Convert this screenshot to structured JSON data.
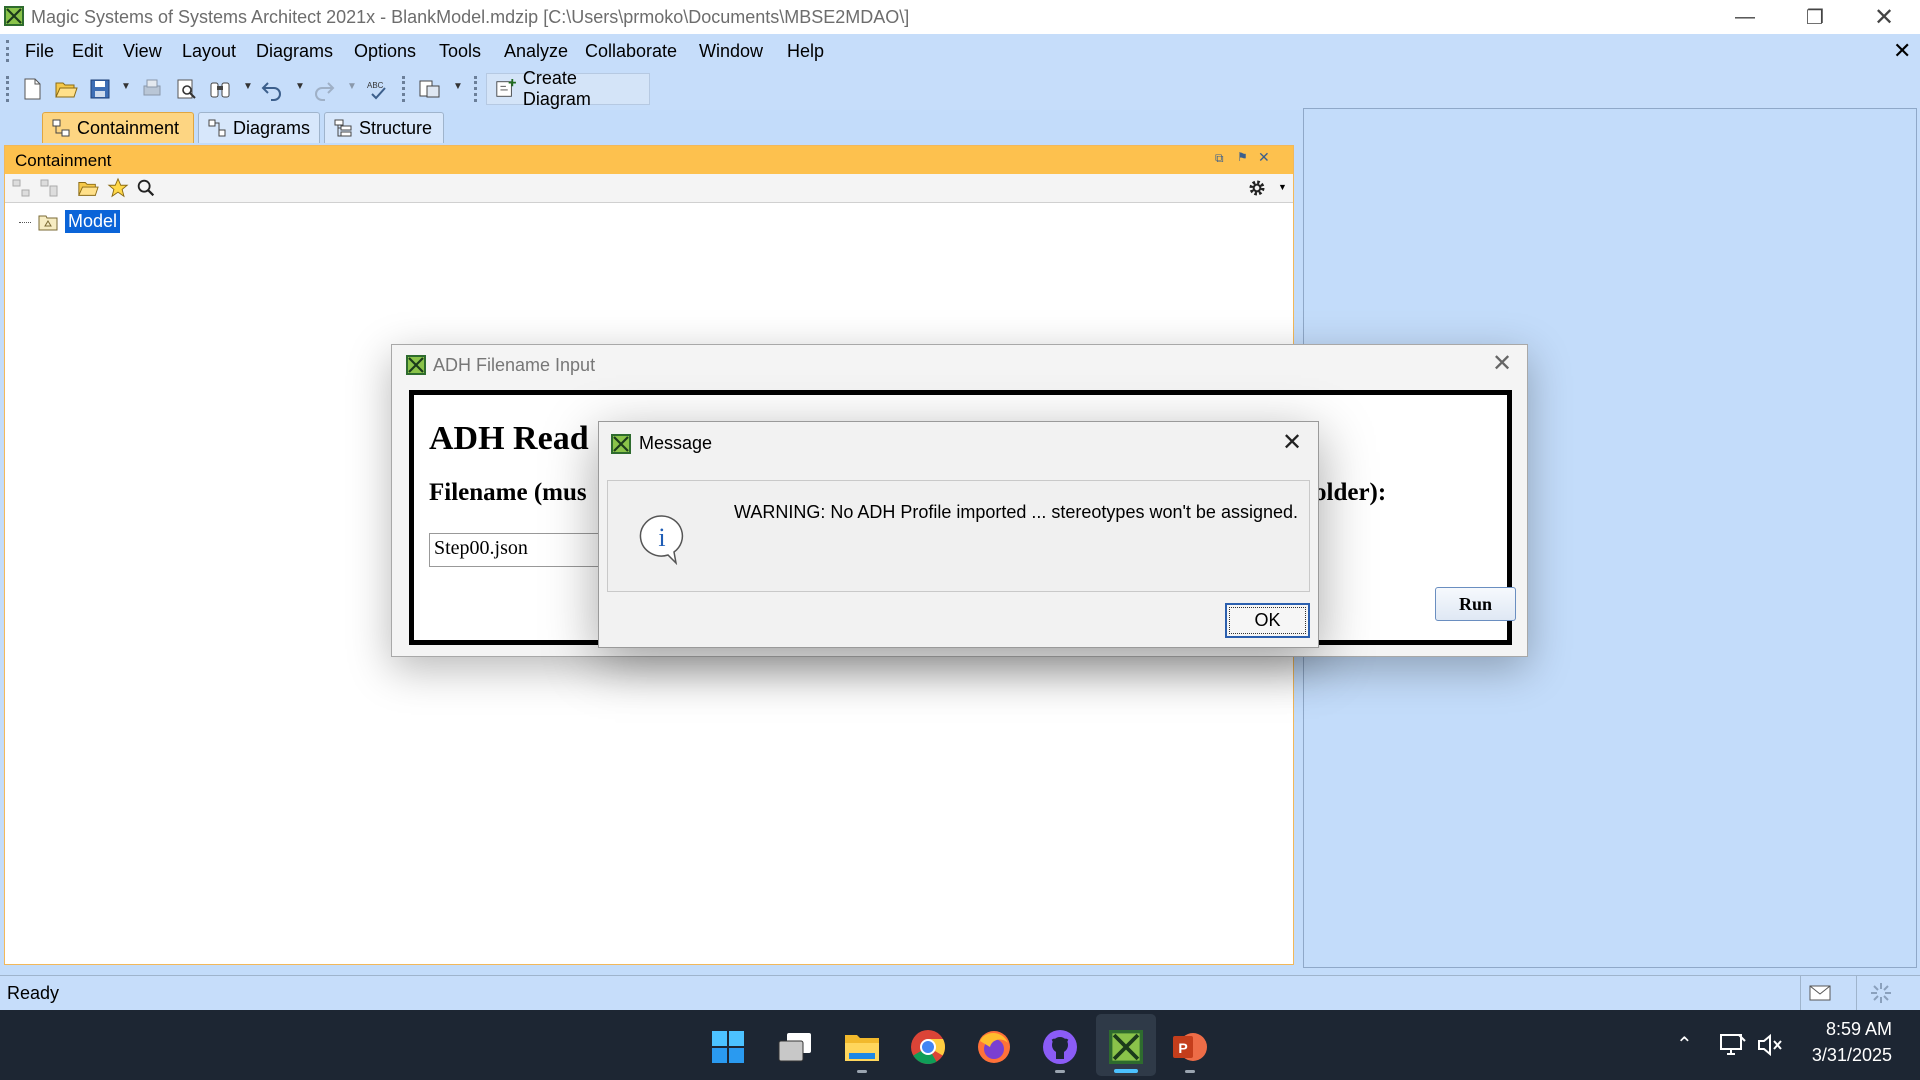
{
  "window": {
    "title": "Magic Systems of Systems Architect 2021x - BlankModel.mdzip [C:\\Users\\prmoko\\Documents\\MBSE2MDAO\\]",
    "minimize_icon": "minimize-icon",
    "maximize_icon": "restore-icon",
    "close_icon": "close-icon"
  },
  "menubar": {
    "items": [
      "File",
      "Edit",
      "View",
      "Layout",
      "Diagrams",
      "Options",
      "Tools",
      "Analyze",
      "Collaborate",
      "Window",
      "Help"
    ],
    "close_icon": "close-icon"
  },
  "toolbar": {
    "create_diagram_label": "Create Diagram",
    "icons": [
      "new-file-icon",
      "open-icon",
      "save-icon",
      "print-icon",
      "print-preview-icon",
      "find-icon",
      "undo-icon",
      "redo-icon",
      "spell-check-icon",
      "export-icon",
      "create-diagram-icon"
    ]
  },
  "browser_tabs": [
    {
      "label": "Containment",
      "active": true
    },
    {
      "label": "Diagrams",
      "active": false
    },
    {
      "label": "Structure",
      "active": false
    }
  ],
  "containment_panel": {
    "title": "Containment",
    "tree": [
      {
        "label": "Model",
        "selected": true
      }
    ]
  },
  "adh_dialog": {
    "title": "ADH Filename Input",
    "heading": "ADH Read",
    "filename_label_left": "Filename (mus",
    "filename_label_right": "older):",
    "filename_value": "Step00.json",
    "run_label": "Run"
  },
  "message_dialog": {
    "title": "Message",
    "message": "WARNING: No ADH Profile imported ... stereotypes won't be assigned.",
    "info_glyph": "i",
    "ok_label": "OK"
  },
  "statusbar": {
    "text": "Ready"
  },
  "taskbar": {
    "apps": [
      "windows-start-icon",
      "task-view-icon",
      "file-explorer-icon",
      "chrome-icon",
      "firefox-icon",
      "github-icon",
      "magic-architect-icon",
      "powerpoint-icon"
    ],
    "time": "8:59 AM",
    "date": "3/31/2025"
  },
  "colors": {
    "accent_blue": "#c6ddfa",
    "panel_header": "#fdc14e",
    "selection": "#0a64d8",
    "taskbar": "#1d2633"
  }
}
